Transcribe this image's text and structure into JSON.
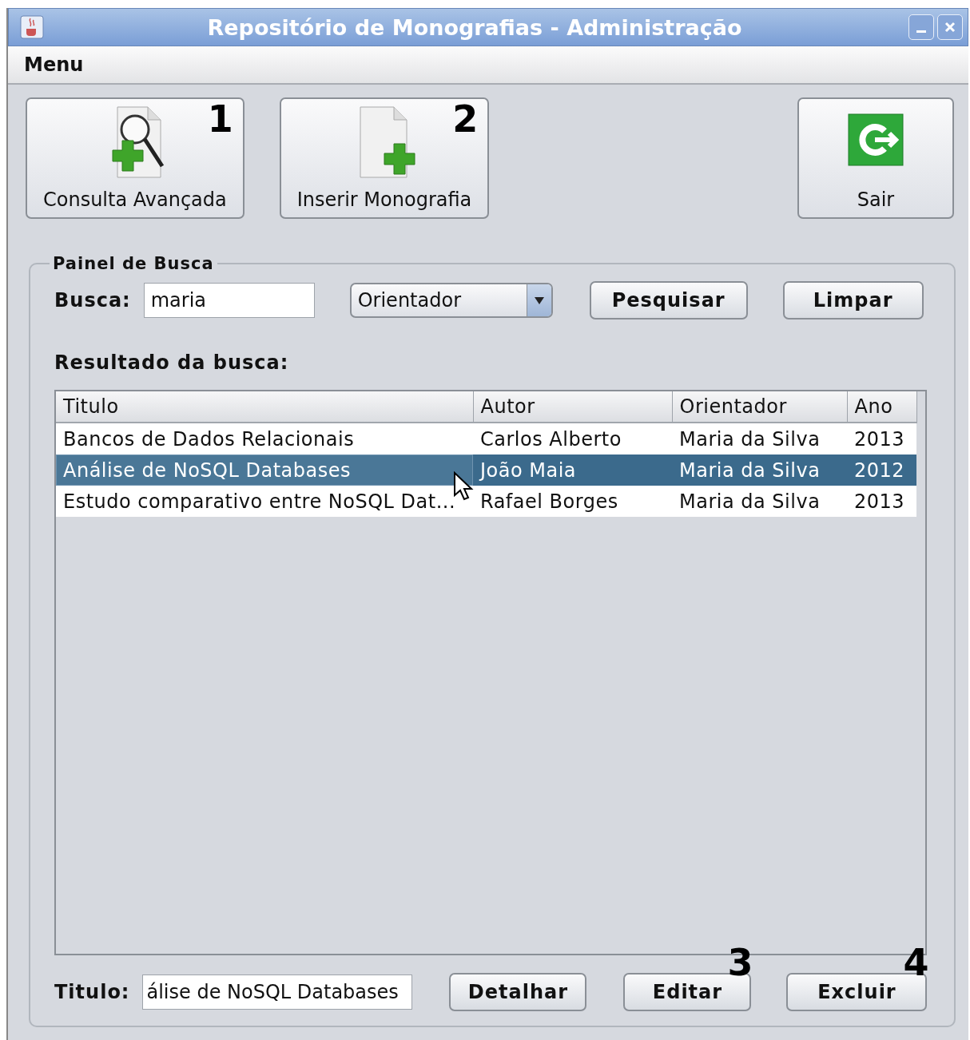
{
  "window": {
    "title": "Repositório de Monografias - Administração"
  },
  "menu_bar": [
    {
      "label": "Menu"
    }
  ],
  "toolbar": [
    {
      "label": "Consulta Avançada",
      "callout": "1",
      "kind": "search"
    },
    {
      "label": "Inserir Monografia",
      "callout": "2",
      "kind": "add"
    },
    {
      "label": "Sair",
      "kind": "exit"
    }
  ],
  "search_panel": {
    "title": "Painel de Busca",
    "search_label": "Busca:",
    "search_value": "maria",
    "filter": "Orientador",
    "buttons": [
      {
        "label": "Pesquisar"
      },
      {
        "label": "Limpar"
      }
    ],
    "results_label": "Resultado da busca:",
    "table": {
      "columns": [
        "Titulo",
        "Autor",
        "Orientador",
        "Ano"
      ],
      "rows": [
        {
          "cells": [
            "Bancos de Dados Relacionais",
            "Carlos Alberto",
            "Maria da Silva",
            "2013"
          ],
          "selected": false
        },
        {
          "cells": [
            "Análise de NoSQL Databases",
            "João Maia",
            "Maria da Silva",
            "2012"
          ],
          "selected": true
        },
        {
          "cells": [
            "Estudo comparativo entre NoSQL Dat...",
            "Rafael Borges",
            "Maria da Silva",
            "2013"
          ],
          "selected": false
        }
      ]
    },
    "title_label": "Titulo:",
    "title_value": "álise de NoSQL Databases",
    "actions": [
      {
        "label": "Detalhar"
      },
      {
        "label": "Editar",
        "callout": "3"
      },
      {
        "label": "Excluir",
        "callout": "4"
      }
    ]
  }
}
